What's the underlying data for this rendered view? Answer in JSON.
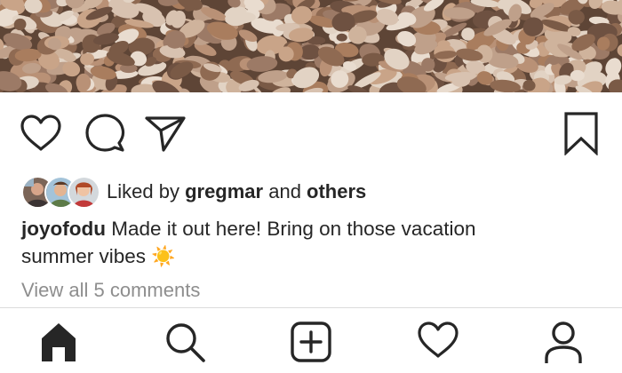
{
  "post": {
    "likes": {
      "prefix": "Liked by ",
      "user": "gregmar",
      "middle": " and ",
      "others": "others"
    },
    "caption": {
      "username": "joyofodu",
      "text_line1": " Made it out here! Bring on those vacation",
      "text_line2": "summer vibes",
      "emoji": "☀️"
    },
    "view_comments": "View all 5 comments"
  },
  "icons": {
    "like": "heart-icon",
    "comment": "comment-bubble-icon",
    "share": "paper-plane-icon",
    "save": "bookmark-icon"
  },
  "bottom_nav": [
    "home-icon",
    "search-icon",
    "new-post-icon",
    "activity-heart-icon",
    "profile-icon"
  ],
  "colors": {
    "text": "#262626",
    "muted": "#8e8e8e",
    "divider": "#dbdbdb",
    "photo_tone": "#b78d6a"
  }
}
